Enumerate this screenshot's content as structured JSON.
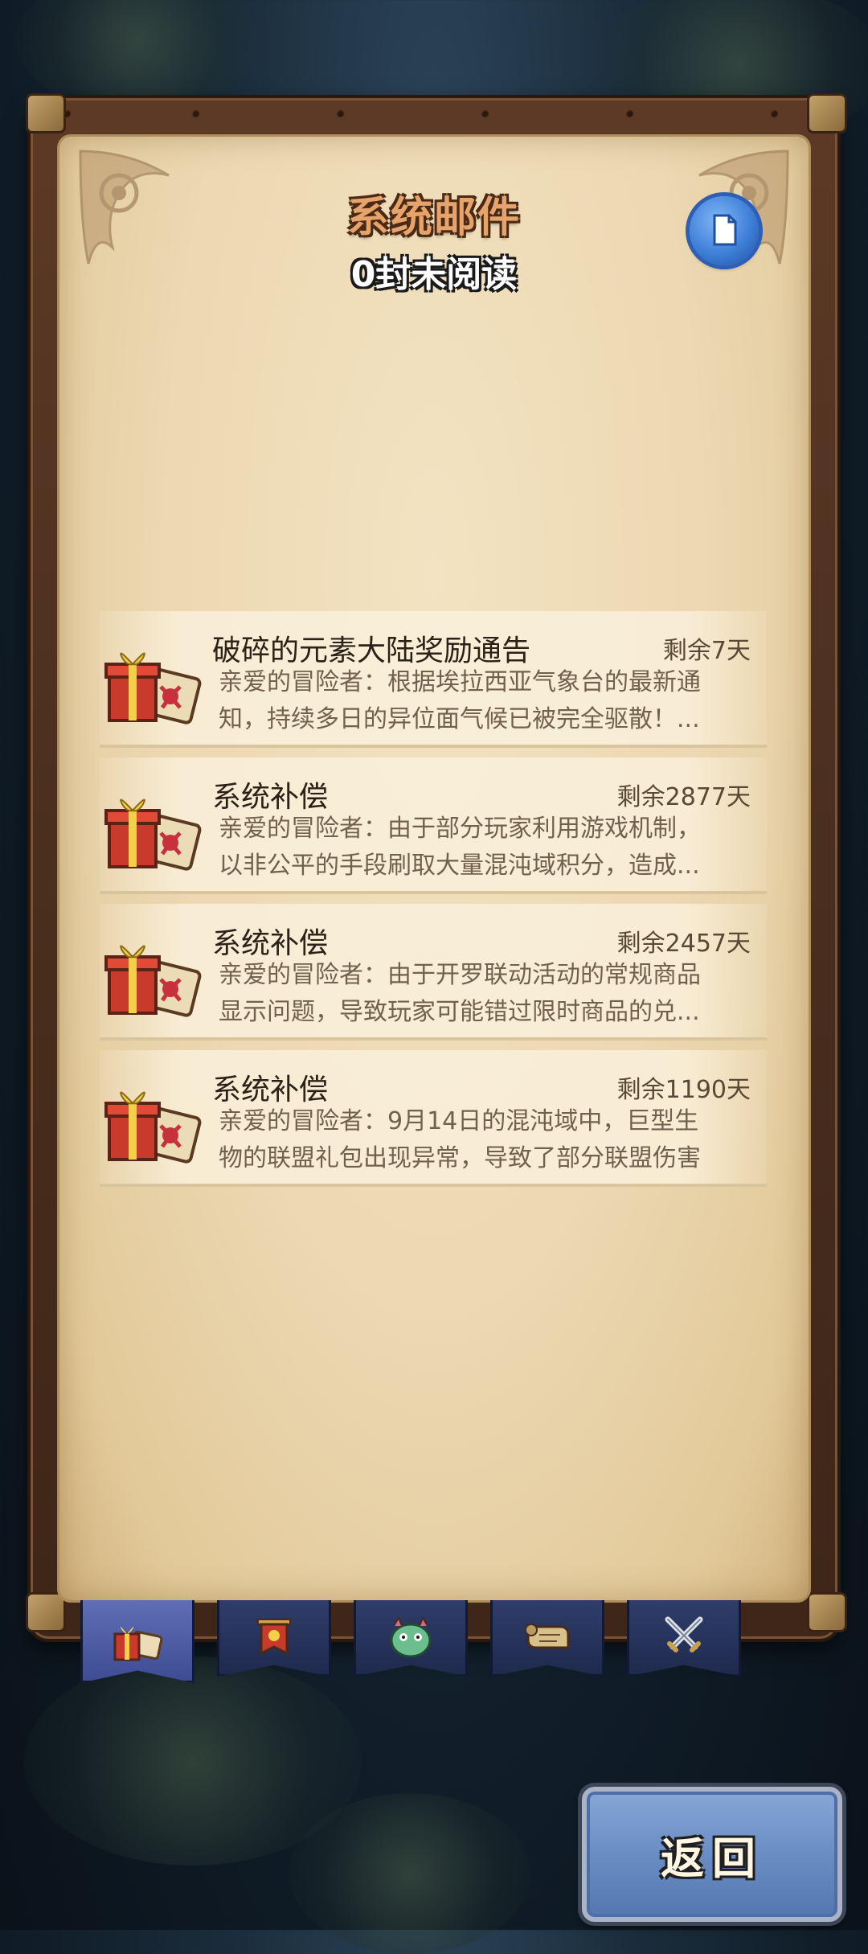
{
  "header": {
    "title": "系统邮件",
    "unread": "0封未阅读"
  },
  "icons": {
    "read_all": "document-icon",
    "mail_item": "gift-box-icon",
    "tabs": [
      "gift-box-icon",
      "banner-icon",
      "monster-icon",
      "scroll-icon",
      "crossed-swords-icon"
    ]
  },
  "mails": [
    {
      "title": "破碎的元素大陆奖励通告",
      "remain": "剩余7天",
      "line1": "亲爱的冒险者：根据埃拉西亚气象台的最新通",
      "line2": "知，持续多日的异位面气候已被完全驱散！..."
    },
    {
      "title": "系统补偿",
      "remain": "剩余2877天",
      "line1": "亲爱的冒险者：由于部分玩家利用游戏机制，",
      "line2": "以非公平的手段刷取大量混沌域积分，造成..."
    },
    {
      "title": "系统补偿",
      "remain": "剩余2457天",
      "line1": "亲爱的冒险者：由于开罗联动活动的常规商品",
      "line2": "显示问题，导致玩家可能错过限时商品的兑..."
    },
    {
      "title": "系统补偿",
      "remain": "剩余1190天",
      "line1": "亲爱的冒险者：9月14日的混沌域中，巨型生",
      "line2": "物的联盟礼包出现异常，导致了部分联盟伤害"
    }
  ],
  "footer": {
    "back_label": "返回"
  },
  "colors": {
    "parchment": "#ecd8b2",
    "frame": "#4a2e1e",
    "tab": "#1f2a4e",
    "tab_active": "#3e4c93",
    "back_button": "#6a8dc4"
  }
}
